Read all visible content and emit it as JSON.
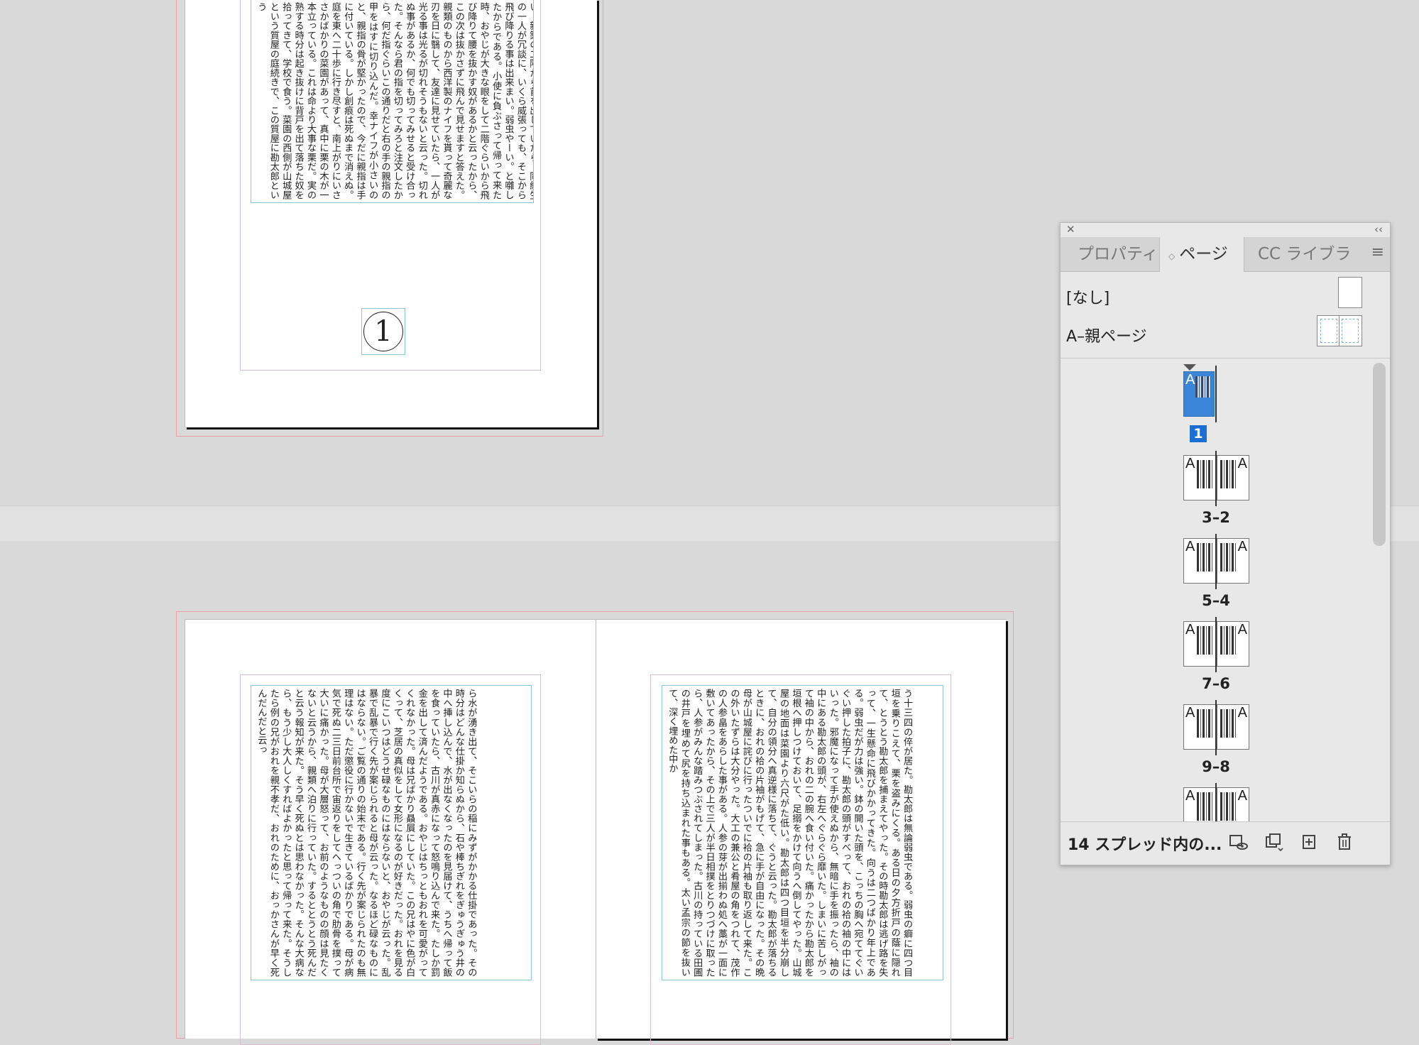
{
  "document": {
    "page1_text": "供の時分から損ばかりしている。小学校に居る時分学校の二階から飛び降りて一週間ほど腰を抜かした事がある。なぜそんな無闇をしたと聞く人があるかも知れぬ。別段深い理由でもない。新築の二階から首を出していたら、同級生の一人が冗談に、いくら威張っても、そこから飛び降りる事は出来まい。弱虫やーい。と囃したからである。小使に負ぶさって帰って来た時、おやじが大きな眼をして二階ぐらいから飛び降りて腰を抜かす奴があるかと云ったから、この次は抜かさずに飛んで見せますと答えた。親類のものから西洋製のナイフを貰って奇麗な刃を日に翳して、友達に見せていたら、一人が光る事は光るが切れそうもないと云った。切れぬ事があるか、何でも切ってみせると受け合った。そんなら君の指を切ってみろと注文したから、何だ指ぐらいこの通りだと右の手の親指の甲をはすに切り込んだ。幸ナイフが小さいのと、親指の骨が堅かったので、今だに親指は手に付いている。しかし創痕は死ぬまで消えぬ。庭を東へ二十歩に行き尽すと、南上がりにいささかばかりの菜園があって、真中に栗の木が一本立っている。これは命より大事な栗だ。実の熟する時分は起き抜けに背戸を出て落ちた奴を拾ってきて、学校で食う。菜園の西側が山城屋という質屋の庭続きで、この質屋に勘太郎という",
    "page_number": "1",
    "page2_text": "う十三四の倅が居た。勘太郎は無論弱虫である。弱虫の癖に四つ目垣を乗りこえて、栗を盗みにくる。ある日の夕方折戸の蔭に隠れて、とうとう勘太郎を捕まえてやった。その時勘太郎は逃げ路を失って、一生懸命に飛びかかってきた。向うは二つばかり年上である。弱虫だが力は強い。鉢の開いた頭を、こっちの胸へ宛ててぐいぐい押した拍子に、勘太郎の頭がすべって、おれの袷の袖の中にはいった。邪魔になって手が使えぬから、無暗に手を振ったら、袖の中にある勘太郎の頭が、右左へぐらぐら靡いた。しまいに苦しがって袖の中から、おれの二の腕へ食い付いた。痛かったから勘太郎を垣根へ押しつけておいて、足搦をかけて向うへ倒してやった。山城屋の地面は菜園より六尺がた低い。勘太郎は四つ目垣を半分崩して、自分の領分へ真逆様に落ちて、ぐうと云った。勘太郎が落ちるときに、おれの袷の片袖がもげて、急に手が自由になった。その晩母が山城屋に詫びに行ったついでに袷の片袖も取り返して来た。この外いたずらは大分やった。大工の兼公と肴屋の角をつれて、茂作の人参畠をあらした事がある。人参の芽が出揃わぬ処へ藁が一面に敷いてあったから、その上で三人が半日相撲をとりつづけに取ったら、人参がみんな踏みつぶされてしまった。古川の持っている田圃の井戸を埋めて尻を持ち込まれた事もある。太い孟宗の節を抜いて、深く埋めた中か",
    "page3_text": "ら水が湧き出て、そこいらの稲にみずがかかる仕掛であった。その時分はどんな仕掛か知らぬから、石や棒ちぎれをぎゅうぎゅう井の中へ挿し込んで、水が出なくなったのを見届けて、うちへ帰って飯を食っていたら、古川が真赤になって怒鳴り込んで来た。たしか罰金を出して済んだようである。おやじはちっともおれを可愛がってくれなかった。母は兄ばかり贔屓にしていた。この兄はやに色が白くって、芝居の真似をして女形になるのが好きだった。おれを見る度にこいつはどうせ碌なものにはならないと、おやじが云った。乱暴で乱暴で行く先が案じられると母が云った。なるほど碌なものにはならない。ご覧の通りの始末である。行く先が案じられたのも無理はない。ただ懲役に行かないで生きているばかりである。母が病気で死ぬ二三日前台所で宙返りをしてへっついの角で肋骨を撲って大いに痛かった。母が大層怒って、お前のようなものの顔は見たくないと云うから、親類へ泊りに行っていた。するととうとう死んだと云う報知が来た。そう早く死ぬとは思わなかった。そんな大病なら、もう少し大人しくすればよかったと思って帰って来た。そうしたら例の兄がおれを親不孝だ、おれのために、おっかさんが早く死んだんだと云っ"
  },
  "panel": {
    "close_glyph": "✕",
    "collapse_glyph": "‹‹",
    "tabs": [
      {
        "label": "プロパティ"
      },
      {
        "label": "ページ",
        "arrows": "◇"
      },
      {
        "label": "CC ライブラ"
      }
    ],
    "menu_glyph": "≡",
    "parents": [
      {
        "label": "[なし]"
      },
      {
        "label": "A–親ページ"
      }
    ],
    "page1_label": "1",
    "master_prefix": "A",
    "spreads": [
      {
        "label": "3–2"
      },
      {
        "label": "5–4"
      },
      {
        "label": "7–6"
      },
      {
        "label": "9–8"
      },
      {
        "label": ""
      }
    ],
    "footer_label": "14 スプレッド内の...",
    "footer_icons": [
      "edit-page-size-icon",
      "new-master-icon",
      "new-page-icon",
      "trash-icon"
    ]
  }
}
